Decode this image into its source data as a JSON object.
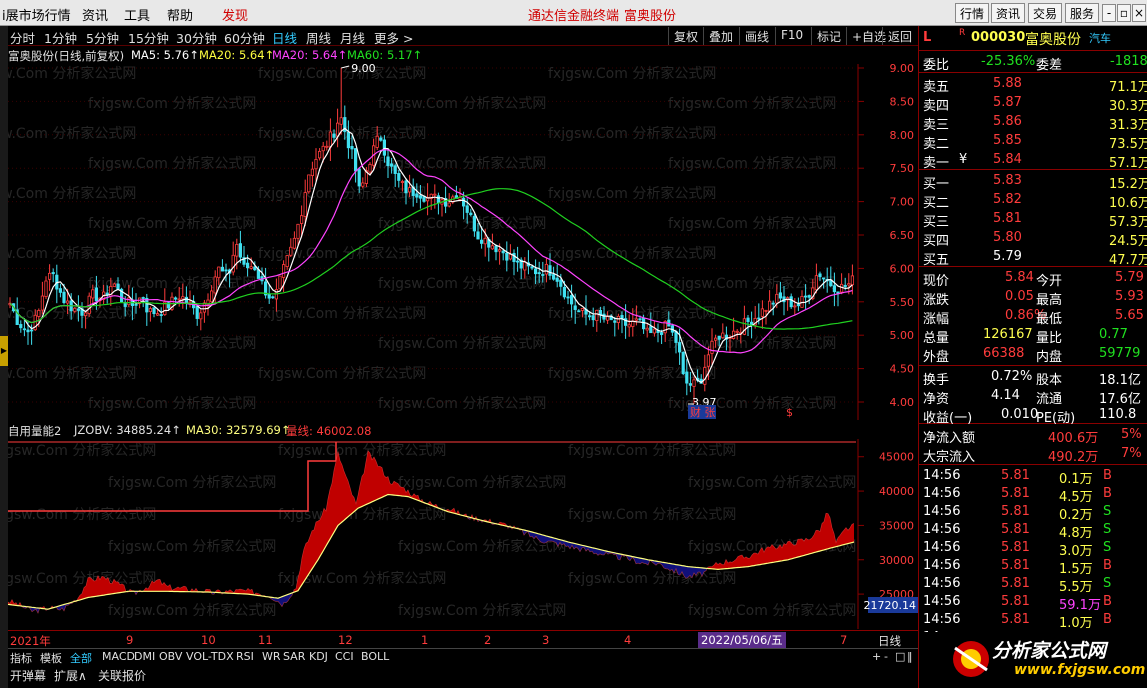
{
  "menu": {
    "items": [
      "ⅰ展市场行情",
      "资讯",
      "工具",
      "帮助",
      "发现"
    ],
    "center": [
      "通达信金融终端",
      "富奥股份"
    ],
    "right_buttons": [
      "行情",
      "资讯",
      "交易",
      "服务"
    ],
    "window_buttons": [
      "-",
      "▫",
      "×"
    ]
  },
  "periods": [
    "分时",
    "1分钟",
    "5分钟",
    "15分钟",
    "30分钟",
    "60分钟",
    "日线",
    "周线",
    "月线",
    "更多 >"
  ],
  "tools": [
    "复权",
    "叠加",
    "画线",
    "F10",
    "标记",
    "+自选",
    "返回"
  ],
  "main": {
    "legend_name": "富奥股份(日线,前复权)",
    "ma5": "MA5: 5.76↑",
    "ma20a": "MA20: 5.64↑",
    "ma20b": "MA20: 5.64↑",
    "ma60": "MA60: 5.17↑",
    "high_marker": "9.00",
    "low_marker": "3.97",
    "event_label": "财 张",
    "event_s": "$",
    "y_ticks": [
      "9.00",
      "8.50",
      "8.00",
      "7.50",
      "7.00",
      "6.50",
      "6.00",
      "5.50",
      "5.00",
      "4.50",
      "4.00"
    ]
  },
  "sub": {
    "name": "自用量能2",
    "jzobv": "JZOBV: 34885.24↑",
    "ma30": "MA30: 32579.69↑",
    "liangxian": "量线: 46002.08",
    "y_ticks": [
      "45000",
      "40000",
      "35000",
      "30000",
      "25000"
    ],
    "current_value": "21720.14"
  },
  "xaxis": {
    "labels": [
      "2021年",
      "9",
      "10",
      "11",
      "12",
      "1",
      "2",
      "3",
      "4",
      "7"
    ],
    "cursor_date": "2022/05/06/五",
    "period_btn": "日线"
  },
  "indicators": [
    "指标",
    "模板",
    "全部",
    "MACD",
    "DMI",
    "OBV",
    "VOL-TDX",
    "RSI",
    "WR",
    "SAR",
    "KDJ",
    "CCI",
    "BOLL"
  ],
  "bottom_tabs": [
    "开弹幕",
    "扩展∧",
    "关联报价"
  ],
  "zoom_btns": [
    "+",
    "-",
    "□",
    "‖"
  ],
  "quote": {
    "flags": [
      "L",
      "R"
    ],
    "code": "000030",
    "name": "富奥股份",
    "tag": "汽车",
    "weibi_label": "委比",
    "weibi": "-25.36%",
    "weicha_label": "委差",
    "weicha": "-1818",
    "asks": [
      {
        "label": "卖五",
        "price": "5.88",
        "vol": "71.1万"
      },
      {
        "label": "卖四",
        "price": "5.87",
        "vol": "30.3万"
      },
      {
        "label": "卖三",
        "price": "5.86",
        "vol": "31.3万"
      },
      {
        "label": "卖二",
        "price": "5.85",
        "vol": "73.5万"
      },
      {
        "label": "卖一",
        "price": "5.84",
        "vol": "57.1万"
      }
    ],
    "bids": [
      {
        "label": "买一",
        "price": "5.83",
        "vol": "15.2万"
      },
      {
        "label": "买二",
        "price": "5.82",
        "vol": "10.6万"
      },
      {
        "label": "买三",
        "price": "5.81",
        "vol": "57.3万"
      },
      {
        "label": "买四",
        "price": "5.80",
        "vol": "24.5万"
      },
      {
        "label": "买五",
        "price": "5.79",
        "vol": "47.7万"
      }
    ],
    "ask_mark": "¥",
    "stats": [
      {
        "l": "现价",
        "v": "5.84",
        "l2": "今开",
        "v2": "5.79"
      },
      {
        "l": "涨跌",
        "v": "0.05",
        "l2": "最高",
        "v2": "5.93"
      },
      {
        "l": "涨幅",
        "v": "0.86%",
        "l2": "最低",
        "v2": "5.65"
      },
      {
        "l": "总量",
        "v": "126167",
        "l2": "量比",
        "v2": "0.77"
      },
      {
        "l": "外盘",
        "v": "66388",
        "l2": "内盘",
        "v2": "59779"
      }
    ],
    "stats2": [
      {
        "l": "换手",
        "v": "0.72%",
        "l2": "股本",
        "v2": "18.1亿"
      },
      {
        "l": "净资",
        "v": "4.14",
        "l2": "流通",
        "v2": "17.6亿"
      },
      {
        "l": "收益(一)",
        "v": "0.010",
        "l2": "PE(动)",
        "v2": "110.8"
      }
    ],
    "flows": [
      {
        "l": "净流入额",
        "v": "400.6万",
        "p": "5%"
      },
      {
        "l": "大宗流入",
        "v": "490.2万",
        "p": "7%"
      }
    ],
    "ticks": [
      {
        "t": "14:56",
        "p": "5.81",
        "v": "0.1万",
        "s": "B"
      },
      {
        "t": "14:56",
        "p": "5.81",
        "v": "4.5万",
        "s": "B"
      },
      {
        "t": "14:56",
        "p": "5.81",
        "v": "0.2万",
        "s": "S"
      },
      {
        "t": "14:56",
        "p": "5.81",
        "v": "4.8万",
        "s": "S"
      },
      {
        "t": "14:56",
        "p": "5.81",
        "v": "3.0万",
        "s": "S"
      },
      {
        "t": "14:56",
        "p": "5.81",
        "v": "1.5万",
        "s": "B"
      },
      {
        "t": "14:56",
        "p": "5.81",
        "v": "5.5万",
        "s": "S"
      },
      {
        "t": "14:56",
        "p": "5.81",
        "v": "59.1万",
        "s": "B"
      },
      {
        "t": "14:56",
        "p": "5.81",
        "v": "1.0万",
        "s": "B"
      },
      {
        "t": "14",
        "p": "",
        "v": "",
        "s": ""
      }
    ],
    "last_row": "笔"
  },
  "watermark": "fxjgsw.Com 分析家公式网",
  "logo": {
    "cn": "分析家公式网",
    "url": "www.fxjgsw.com"
  },
  "colors": {
    "up": "#ff3c3c",
    "down": "#40e0f0",
    "ma5": "#ffffff",
    "ma20": "#ff44ff",
    "ma60": "#20d020",
    "area_up": "#c00000",
    "area_down": "#10107a",
    "ma30": "#ffff80"
  }
}
